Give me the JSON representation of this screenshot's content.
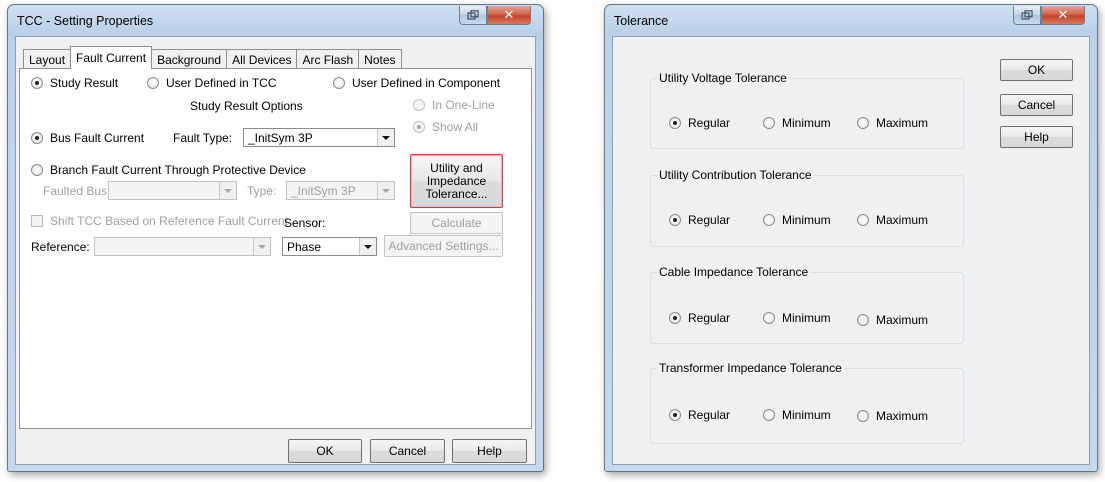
{
  "tcc_window": {
    "title": "TCC - Setting Properties",
    "tabs": [
      "Layout",
      "Fault Current",
      "Background",
      "All Devices",
      "Arc Flash",
      "Notes"
    ],
    "source": {
      "study_result": "Study Result",
      "user_defined_tcc": "User Defined in TCC",
      "user_defined_component": "User Defined in Component"
    },
    "study_result_options": "Study Result Options",
    "in_one_line": "In One-Line",
    "show_all": "Show All",
    "bus_fault_current": "Bus Fault Current",
    "fault_type_label": "Fault Type:",
    "fault_type_value": "_InitSym 3P",
    "branch_fault_current": "Branch Fault Current Through Protective Device",
    "faulted_bus_label": "Faulted Bus:",
    "faulted_bus_value": "",
    "type_label": "Type:",
    "type_value": "_InitSym 3P",
    "utility_tolerance_button": "Utility and Impedance Tolerance...",
    "shift_tcc": "Shift TCC Based on Reference Fault Current",
    "sensor_label": "Sensor:",
    "sensor_value": "Phase",
    "calculate_button": "Calculate",
    "reference_label": "Reference:",
    "reference_value": "",
    "advanced_settings_button": "Advanced Settings...",
    "ok_button": "OK",
    "cancel_button": "Cancel",
    "help_button": "Help"
  },
  "tolerance_window": {
    "title": "Tolerance",
    "groups": [
      {
        "title": "Utility Voltage Tolerance",
        "options": [
          "Regular",
          "Minimum",
          "Maximum"
        ],
        "selected": "Regular"
      },
      {
        "title": "Utility Contribution Tolerance",
        "options": [
          "Regular",
          "Minimum",
          "Maximum"
        ],
        "selected": "Regular"
      },
      {
        "title": "Cable Impedance Tolerance",
        "options": [
          "Regular",
          "Minimum",
          "Maximum"
        ],
        "selected": "Regular"
      },
      {
        "title": "Transformer Impedance Tolerance",
        "options": [
          "Regular",
          "Minimum",
          "Maximum"
        ],
        "selected": "Regular"
      }
    ],
    "ok_button": "OK",
    "cancel_button": "Cancel",
    "help_button": "Help"
  },
  "icons": {
    "restore": "restore-icon",
    "close": "close-icon",
    "dropdown": "chevron-down-icon"
  },
  "colors": {
    "title_bar": "#bcd2e8",
    "close_button": "#c3432a",
    "focus_highlight": "#e23a3a",
    "dialog_face": "#f0f0f0"
  }
}
